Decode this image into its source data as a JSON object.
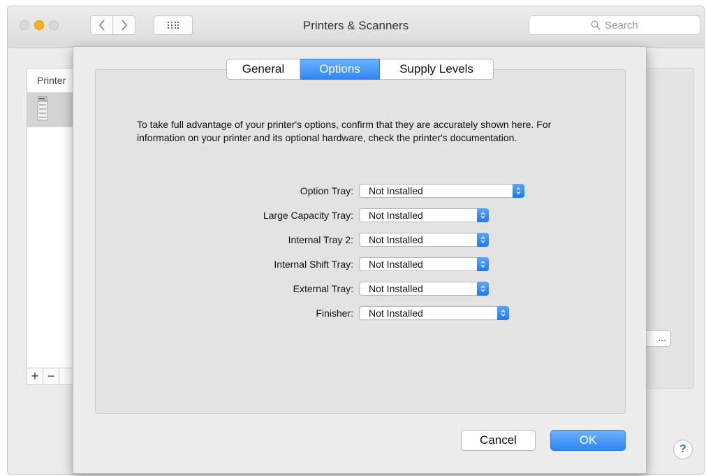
{
  "window": {
    "title": "Printers & Scanners",
    "search_placeholder": "Search"
  },
  "background": {
    "sidebar_header": "Printer",
    "add_label": "+",
    "remove_label": "−",
    "partial_button_label": "...",
    "help_label": "?"
  },
  "sheet": {
    "tabs": [
      {
        "label": "General",
        "active": false
      },
      {
        "label": "Options",
        "active": true
      },
      {
        "label": "Supply Levels",
        "active": false
      }
    ],
    "description": "To take full advantage of your printer's options, confirm that they are accurately shown here. For information on your printer and its optional hardware, check the printer's documentation.",
    "options": [
      {
        "label": "Option Tray:",
        "value": "Not Installed"
      },
      {
        "label": "Large Capacity Tray:",
        "value": "Not Installed"
      },
      {
        "label": "Internal Tray 2:",
        "value": "Not Installed"
      },
      {
        "label": "Internal Shift Tray:",
        "value": "Not Installed"
      },
      {
        "label": "External Tray:",
        "value": "Not Installed"
      },
      {
        "label": "Finisher:",
        "value": "Not Installed"
      }
    ],
    "cancel_label": "Cancel",
    "ok_label": "OK"
  },
  "colors": {
    "accent": "#2f86f5",
    "window_bg": "#ececec",
    "traffic_minimize": "#f3b11e"
  }
}
